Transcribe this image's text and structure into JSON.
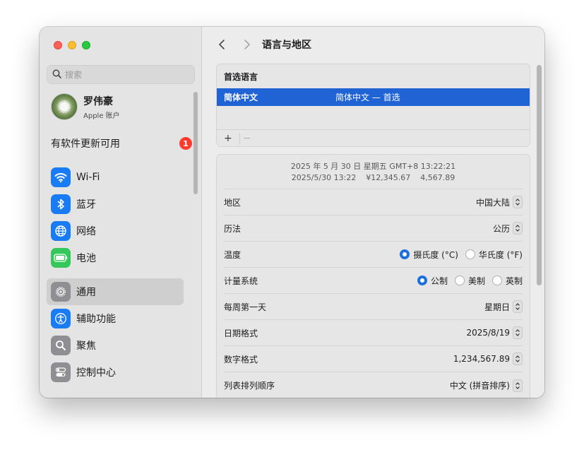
{
  "sidebar": {
    "search_placeholder": "搜索",
    "profile": {
      "name": "罗伟豪",
      "sub": "Apple 账户"
    },
    "update": {
      "label": "有软件更新可用",
      "badge": "1"
    },
    "items": [
      {
        "label": "Wi-Fi",
        "icon": "wifi-icon",
        "color": "#1a7cf5"
      },
      {
        "label": "蓝牙",
        "icon": "bluetooth-icon",
        "color": "#1a7cf5"
      },
      {
        "label": "网络",
        "icon": "globe-icon",
        "color": "#1a7cf5"
      },
      {
        "label": "电池",
        "icon": "battery-icon",
        "color": "#34c759"
      },
      {
        "label": "通用",
        "icon": "gear-icon",
        "color": "#8e8e93",
        "active": true
      },
      {
        "label": "辅助功能",
        "icon": "accessibility-icon",
        "color": "#1a7cf5"
      },
      {
        "label": "聚焦",
        "icon": "magnifier-icon",
        "color": "#8e8e93"
      },
      {
        "label": "控制中心",
        "icon": "control-center-icon",
        "color": "#8e8e93"
      }
    ]
  },
  "toolbar": {
    "title": "语言与地区"
  },
  "languages": {
    "header": "首选语言",
    "rows": [
      {
        "name": "简体中文",
        "detail": "简体中文 — 首选"
      }
    ],
    "add": "+",
    "remove": "−"
  },
  "preview": {
    "line1": "2025 年 5 月 30 日 星期五 GMT+8 13:22:21",
    "line2": "2025/5/30 13:22    ¥12,345.67    4,567.89"
  },
  "settings": {
    "region": {
      "label": "地区",
      "value": "中国大陆"
    },
    "calendar": {
      "label": "历法",
      "value": "公历"
    },
    "temperature": {
      "label": "温度",
      "options": [
        "摄氏度 (°C)",
        "华氏度 (°F)"
      ],
      "selected": 0
    },
    "measure": {
      "label": "计量系统",
      "options": [
        "公制",
        "美制",
        "英制"
      ],
      "selected": 0
    },
    "first_day": {
      "label": "每周第一天",
      "value": "星期日"
    },
    "date_format": {
      "label": "日期格式",
      "value": "2025/8/19"
    },
    "number_format": {
      "label": "数字格式",
      "value": "1,234,567.89"
    },
    "list_sort": {
      "label": "列表排列顺序",
      "value": "中文 (拼音排序)"
    }
  },
  "colors": {
    "accent": "#1f63d4",
    "close": "#fe5f57",
    "minimize": "#febc2e",
    "maximize": "#28c840",
    "badge": "#ff3b30"
  }
}
